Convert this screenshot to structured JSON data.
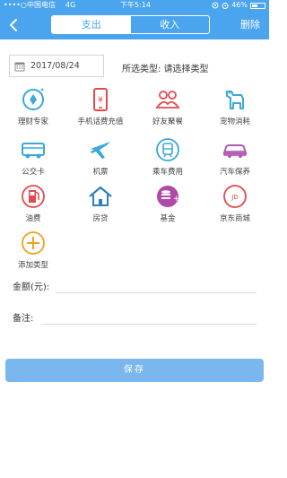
{
  "status_bar": {
    "signal": "••••○",
    "carrier": "中国电信",
    "network": "4G",
    "time": "下午5:14",
    "battery": "46%",
    "battery_level": 0.46
  },
  "nav": {
    "tabs": [
      {
        "label": "支出",
        "active": true
      },
      {
        "label": "收入",
        "active": false
      }
    ],
    "delete_label": "删除"
  },
  "date": "2017/08/24",
  "type_label": "所选类型: 请选择类型",
  "categories": [
    {
      "label": "理财专家",
      "icon": "finance-icon",
      "color": "#3aa8d9"
    },
    {
      "label": "手机话费充值",
      "icon": "phone-topup-icon",
      "color": "#e5484d"
    },
    {
      "label": "好友聚餐",
      "icon": "friends-dinner-icon",
      "color": "#e5484d"
    },
    {
      "label": "宠物消耗",
      "icon": "dog-icon",
      "color": "#3aa8d9"
    },
    {
      "label": "公交卡",
      "icon": "bus-icon",
      "color": "#3aa8d9"
    },
    {
      "label": "机票",
      "icon": "airplane-icon",
      "color": "#3aa8d9"
    },
    {
      "label": "乘车费用",
      "icon": "train-icon",
      "color": "#3aa8d9"
    },
    {
      "label": "汽车保养",
      "icon": "car-icon",
      "color": "#b45ab5"
    },
    {
      "label": "油费",
      "icon": "fuel-icon",
      "color": "#e5484d"
    },
    {
      "label": "房贷",
      "icon": "house-icon",
      "color": "#2f7fc0"
    },
    {
      "label": "基金",
      "icon": "fund-coins-icon",
      "color": "#b04aa8"
    },
    {
      "label": "京东商城",
      "icon": "jd-icon",
      "color": "#e5484d"
    },
    {
      "label": "添加类型",
      "icon": "add-icon",
      "color": "#f0a020"
    }
  ],
  "amount_label": "金额(元):",
  "note_label": "备注:",
  "save_label": "保存"
}
